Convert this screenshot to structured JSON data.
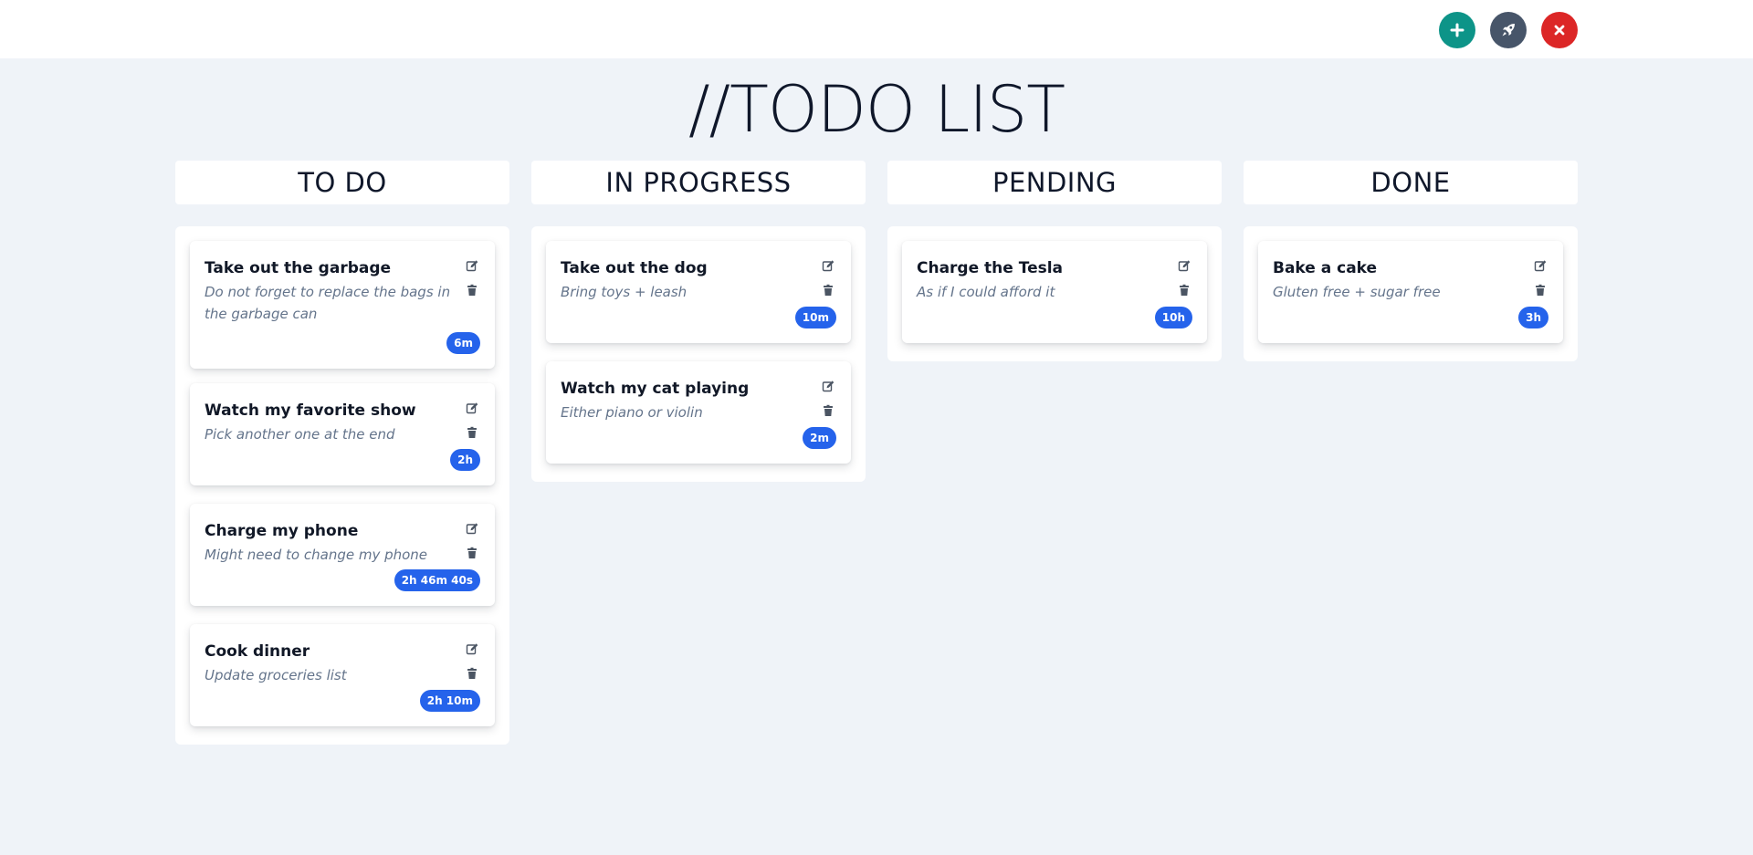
{
  "toolbar": {
    "add_icon": "plus-icon",
    "launch_icon": "rocket-icon",
    "close_icon": "close-icon",
    "colors": {
      "add": "#0d9488",
      "launch": "#475569",
      "close": "#dc2626"
    }
  },
  "page_title": "//TODO LIST",
  "columns": [
    {
      "title": "TO DO",
      "cards": [
        {
          "title": "Take out the garbage",
          "description": "Do not forget to replace the bags in the garbage can",
          "time": "6m"
        },
        {
          "title": "Watch my favorite show",
          "description": "Pick another one at the end",
          "time": "2h"
        },
        {
          "title": "Charge my phone",
          "description": "Might need to change my phone",
          "time": "2h 46m 40s"
        },
        {
          "title": "Cook dinner",
          "description": "Update groceries list",
          "time": "2h 10m"
        }
      ]
    },
    {
      "title": "IN PROGRESS",
      "cards": [
        {
          "title": "Take out the dog",
          "description": "Bring toys + leash",
          "time": "10m"
        },
        {
          "title": "Watch my cat playing",
          "description": "Either piano or violin",
          "time": "2m"
        }
      ]
    },
    {
      "title": "PENDING",
      "cards": [
        {
          "title": "Charge the Tesla",
          "description": "As if I could afford it",
          "time": "10h"
        }
      ]
    },
    {
      "title": "DONE",
      "cards": [
        {
          "title": "Bake a cake",
          "description": "Gluten free + sugar free",
          "time": "3h"
        }
      ]
    }
  ],
  "card_icons": {
    "edit": "edit-icon",
    "delete": "trash-icon"
  },
  "badge_color": "#2563eb"
}
